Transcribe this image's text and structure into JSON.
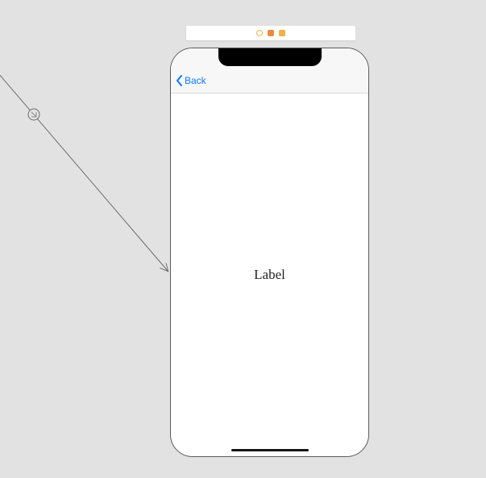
{
  "navbar": {
    "back_label": "Back"
  },
  "content": {
    "label_text": "Label"
  },
  "icons": {
    "scene_circle": "scene-view-controller-outline-icon",
    "scene_hex": "scene-first-responder-icon",
    "scene_square": "scene-exit-icon",
    "back_chevron": "chevron-left-icon",
    "segue_badge": "segue-show-icon"
  }
}
